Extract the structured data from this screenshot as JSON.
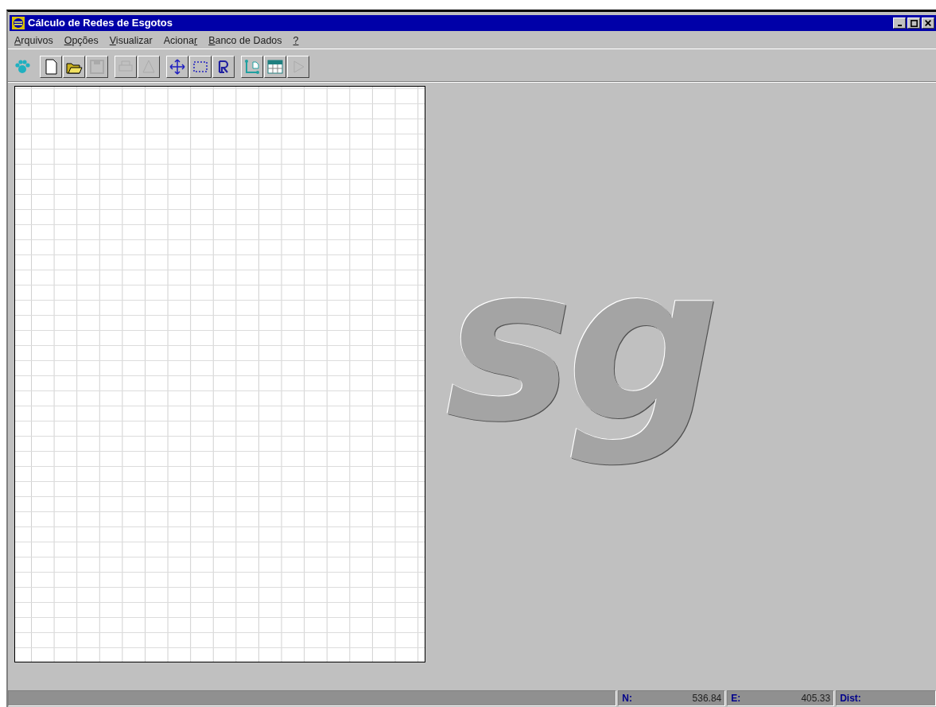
{
  "window": {
    "title": "Cálculo de Redes de Esgotos"
  },
  "menu": [
    {
      "key": "A",
      "rest": "rquivos"
    },
    {
      "key": "O",
      "rest": "pções"
    },
    {
      "key": "V",
      "rest": "isualizar"
    },
    {
      "before": "Aciona",
      "key": "r"
    },
    {
      "key": "B",
      "rest": "anco de Dados"
    },
    {
      "key": "?"
    }
  ],
  "toolbar": [
    [
      {
        "kind": "paw",
        "disabled": false,
        "flat": true
      }
    ],
    [
      {
        "kind": "new",
        "disabled": false
      },
      {
        "kind": "open",
        "disabled": false
      },
      {
        "kind": "save",
        "disabled": true
      }
    ],
    [
      {
        "kind": "print",
        "disabled": true
      },
      {
        "kind": "preview",
        "disabled": true
      }
    ],
    [
      {
        "kind": "move",
        "disabled": false
      },
      {
        "kind": "select",
        "disabled": false
      },
      {
        "kind": "letter-r",
        "disabled": false
      }
    ],
    [
      {
        "kind": "network",
        "disabled": false
      },
      {
        "kind": "table",
        "disabled": false
      },
      {
        "kind": "play",
        "disabled": true
      }
    ]
  ],
  "background_logo": "sg",
  "status_bar": [
    {
      "label": "N:",
      "value": "536.84"
    },
    {
      "label": "E:",
      "value": "405.33"
    },
    {
      "label": "Dist:"
    }
  ]
}
